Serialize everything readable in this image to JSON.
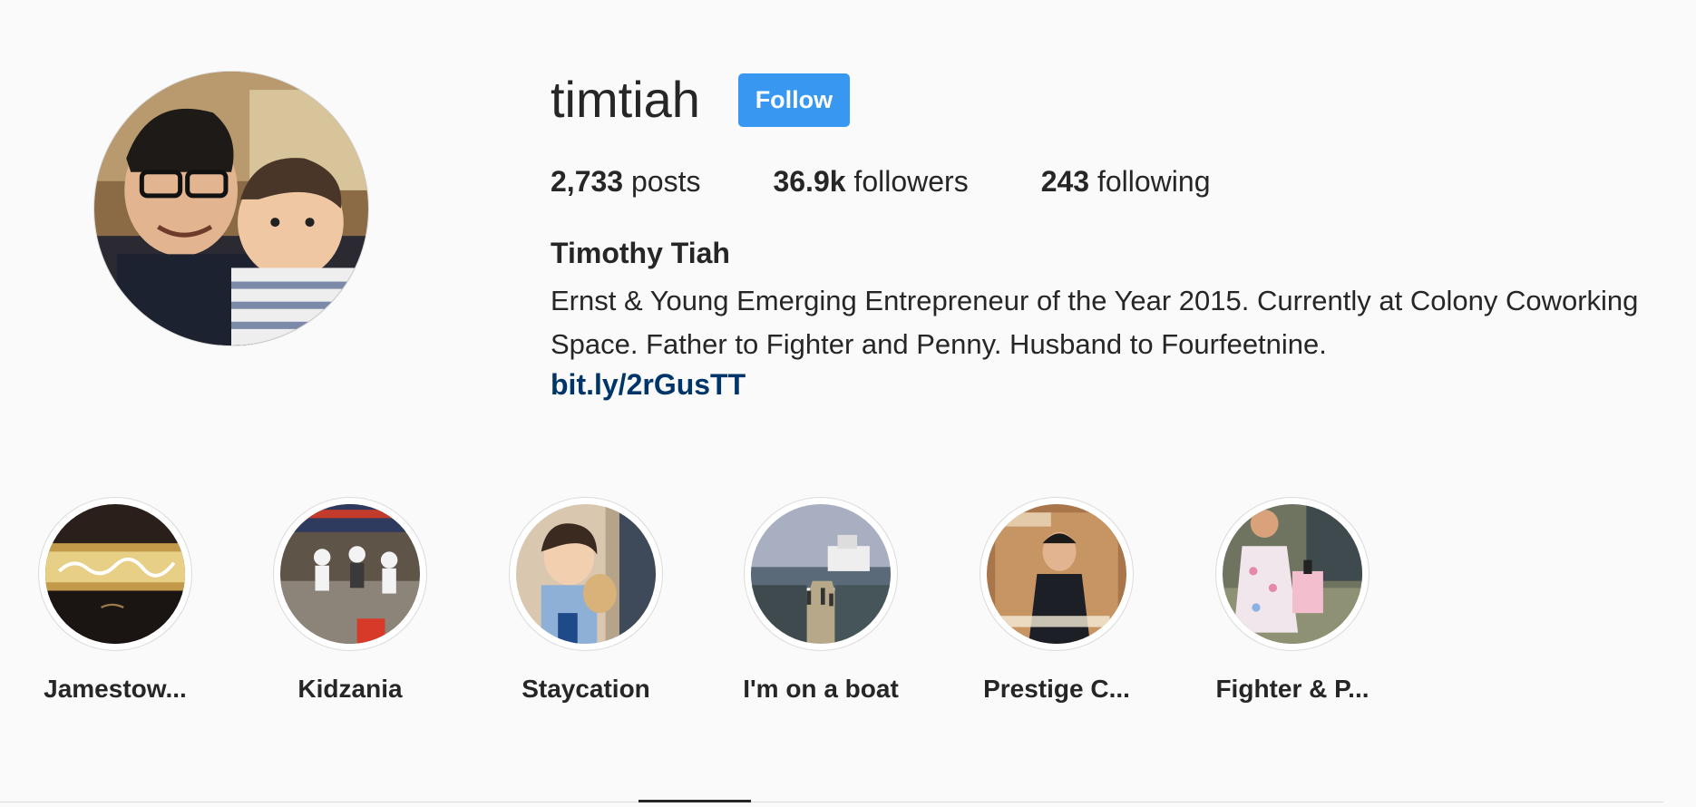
{
  "profile": {
    "username": "timtiah",
    "follow_label": "Follow",
    "stats": [
      {
        "count": "2,733",
        "label": "posts"
      },
      {
        "count": "36.9k",
        "label": "followers"
      },
      {
        "count": "243",
        "label": "following"
      }
    ],
    "full_name": "Timothy Tiah",
    "bio": "Ernst & Young Emerging Entrepreneur of the Year 2015. Currently at Colony Coworking Space. Father to Fighter and Penny. Husband to Fourfeetnine.",
    "link": "bit.ly/2rGusTT"
  },
  "highlights": [
    {
      "label": "Jamestow..."
    },
    {
      "label": "Kidzania"
    },
    {
      "label": "Staycation"
    },
    {
      "label": "I'm on a boat"
    },
    {
      "label": "Prestige C..."
    },
    {
      "label": "Fighter & P..."
    }
  ],
  "colors": {
    "follow_button": "#3897f0",
    "link": "#003569",
    "background": "#fafafa"
  }
}
